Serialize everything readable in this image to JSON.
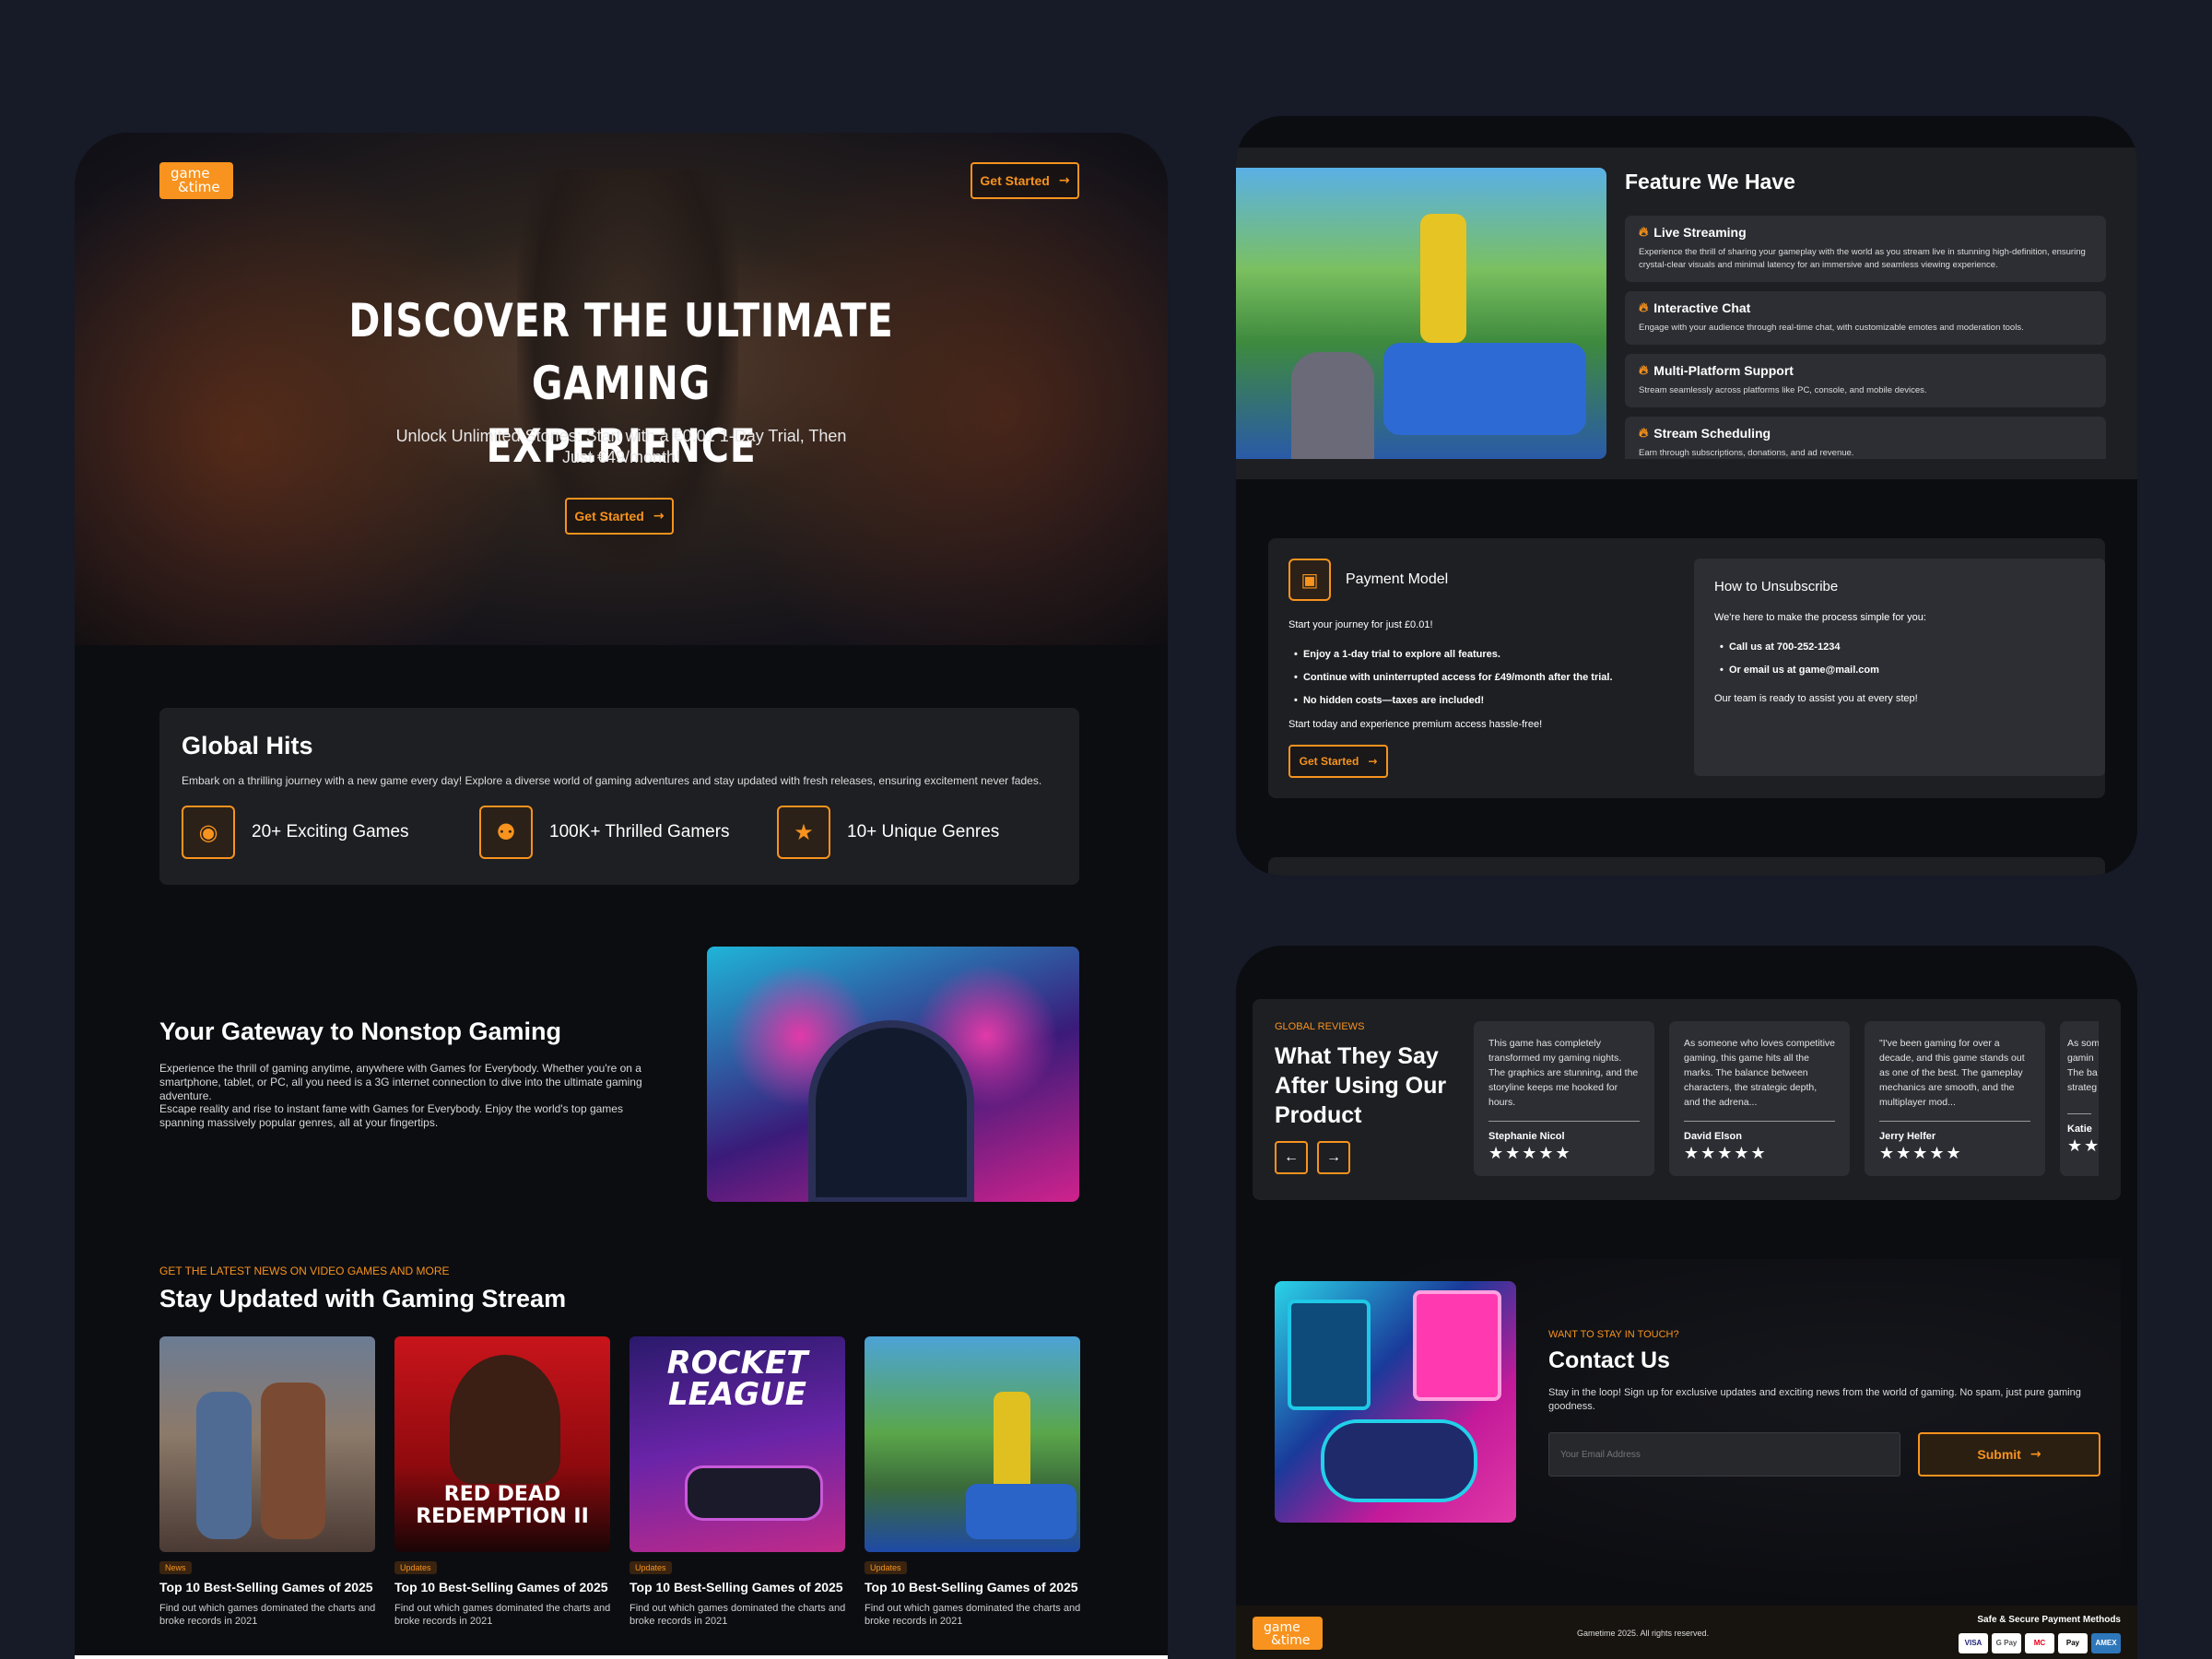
{
  "brand": {
    "logo_line1": "game",
    "logo_line2": "&time"
  },
  "hero": {
    "cta": "Get Started",
    "title_line1": "DISCOVER THE ULTIMATE GAMING",
    "title_line2": "EXPERIENCE",
    "subtitle": "Unlock Unlimited Stories: Start with a €0.01 1-Day Trial, Then Just €49/month!",
    "cta2": "Get Started"
  },
  "global_hits": {
    "title": "Global Hits",
    "desc": "Embark on a thrilling journey with a new game every day! Explore a diverse world of gaming adventures and stay updated with fresh releases, ensuring excitement never fades.",
    "stats": [
      {
        "icon": "gamepad-icon",
        "label": "20+ Exciting Games"
      },
      {
        "icon": "users-icon",
        "label": "100K+ Thrilled Gamers"
      },
      {
        "icon": "star-box-icon",
        "label": "10+ Unique Genres"
      }
    ]
  },
  "gateway": {
    "title": "Your Gateway to Nonstop Gaming",
    "p1": "Experience the thrill of gaming anytime, anywhere with Games for Everybody. Whether you're on a smartphone, tablet, or PC, all you need is a 3G internet connection to dive into the ultimate gaming adventure.",
    "p2": "Escape reality and rise to instant fame with Games for Everybody. Enjoy the world's top games spanning massively popular genres, all at your fingertips."
  },
  "news": {
    "eyebrow": "GET THE LATEST NEWS ON VIDEO GAMES AND MORE",
    "title": "Stay Updated with Gaming Stream",
    "items": [
      {
        "tag": "News",
        "title": "Top 10 Best-Selling Games of 2025",
        "desc": "Find out which games dominated the charts and broke records in 2021"
      },
      {
        "tag": "Updates",
        "title": "Top 10 Best-Selling Games of 2025",
        "desc": "Find out which games dominated the charts and broke records in 2021"
      },
      {
        "tag": "Updates",
        "title": "Top 10 Best-Selling Games of 2025",
        "desc": "Find out which games dominated the charts and broke records in 2021"
      },
      {
        "tag": "Updates",
        "title": "Top 10 Best-Selling Games of 2025",
        "desc": "Find out which games dominated the charts and broke records in 2021"
      }
    ],
    "img2_text": "RED DEAD REDEMPTION II",
    "img3_text": "ROCKET LEAGUE"
  },
  "features": {
    "title": "Feature We Have",
    "items": [
      {
        "title": "Live Streaming",
        "desc": "Experience the thrill of sharing your gameplay with the world as you stream live in stunning high-definition, ensuring crystal-clear visuals and minimal latency for an immersive and seamless viewing experience."
      },
      {
        "title": "Interactive Chat",
        "desc": "Engage with your audience through real-time chat, with customizable emotes and moderation tools."
      },
      {
        "title": "Multi-Platform Support",
        "desc": "Stream seamlessly across platforms like PC, console, and mobile devices."
      },
      {
        "title": "Stream Scheduling",
        "desc": "Earn through subscriptions, donations, and ad revenue."
      }
    ]
  },
  "payment": {
    "title": "Payment Model",
    "intro": "Start your journey for just £0.01!",
    "bullets": [
      "Enjoy a 1-day trial to explore all features.",
      "Continue with uninterrupted access for £49/month after the trial.",
      "No hidden costs—taxes are included!"
    ],
    "outro": "Start today and experience premium access hassle-free!",
    "cta": "Get Started"
  },
  "unsubscribe": {
    "title": "How to Unsubscribe",
    "intro": "We're here to make the process simple for you:",
    "bullets": [
      "Call us at 700-252-1234",
      "Or email us at game@mail.com"
    ],
    "outro": "Our team is ready to assist you at every step!"
  },
  "reviews": {
    "eyebrow": "GLOBAL REVIEWS",
    "title": "What They Say After Using Our Product",
    "stars": "★★★★★",
    "items": [
      {
        "text": "This game has completely transformed my gaming nights. The graphics are stunning, and the storyline keeps me hooked for hours.",
        "name": "Stephanie Nicol"
      },
      {
        "text": "As someone who loves competitive gaming, this game hits all the marks. The balance between characters, the strategic depth, and the adrena...",
        "name": "David Elson"
      },
      {
        "text": "\"I've been gaming for over a decade, and this game stands out as one of the best. The gameplay mechanics are smooth, and the multiplayer mod...",
        "name": "Jerry Helfer"
      },
      {
        "text": "As som gamin The ba strateg",
        "name": "Katie"
      }
    ]
  },
  "contact": {
    "eyebrow": "WANT TO STAY IN TOUCH?",
    "title": "Contact Us",
    "desc": "Stay in the loop! Sign up for exclusive updates and exciting news from the world of gaming. No spam, just pure gaming goodness.",
    "placeholder": "Your Email Address",
    "submit": "Submit"
  },
  "footer": {
    "copyright": "Gametime 2025. All rights reserved.",
    "payments_title": "Safe & Secure Payment Methods",
    "payments": [
      "VISA",
      "G Pay",
      "MC",
      "Pay",
      "AMEX"
    ]
  },
  "colors": {
    "accent": "#f7931e",
    "bg": "#171a27",
    "panel": "#0c0d11",
    "card": "#1e1f23"
  }
}
